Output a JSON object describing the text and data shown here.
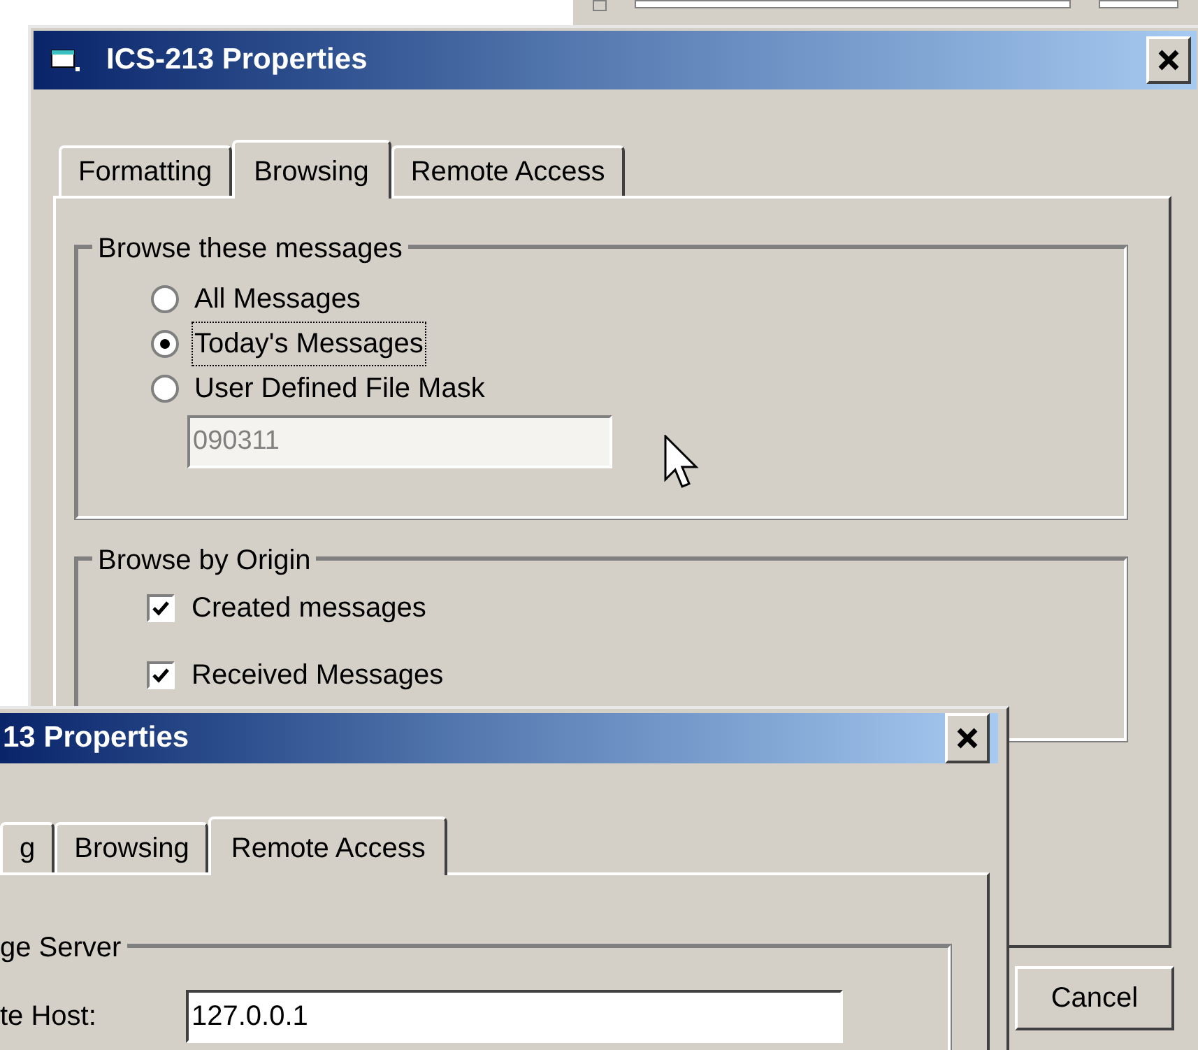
{
  "main_window": {
    "title": "ICS-213 Properties",
    "tabs": [
      {
        "label": "Formatting",
        "selected": false
      },
      {
        "label": "Browsing",
        "selected": true
      },
      {
        "label": "Remote Access",
        "selected": false
      }
    ],
    "groups": [
      {
        "kind": "radio",
        "title": "Browse these messages",
        "options": [
          {
            "label": "All Messages",
            "selected": false,
            "focused": false
          },
          {
            "label": "Today's Messages",
            "selected": true,
            "focused": true
          },
          {
            "label": "User Defined File Mask",
            "selected": false,
            "focused": false
          }
        ],
        "field": {
          "value": "090311",
          "disabled": true
        }
      },
      {
        "kind": "checkbox",
        "title": "Browse by Origin",
        "options": [
          {
            "label": "Created messages",
            "checked": true
          },
          {
            "label": "Received Messages",
            "checked": true
          }
        ]
      }
    ],
    "buttons": [
      "Cancel"
    ]
  },
  "front_window": {
    "title": "13 Properties",
    "tabs": [
      {
        "label": "g",
        "selected": false
      },
      {
        "label": "Browsing",
        "selected": false
      },
      {
        "label": "Remote Access",
        "selected": true
      }
    ],
    "group": {
      "title": "ge Server",
      "fields": [
        {
          "label": "te Host:",
          "value": "127.0.0.1"
        }
      ]
    }
  }
}
